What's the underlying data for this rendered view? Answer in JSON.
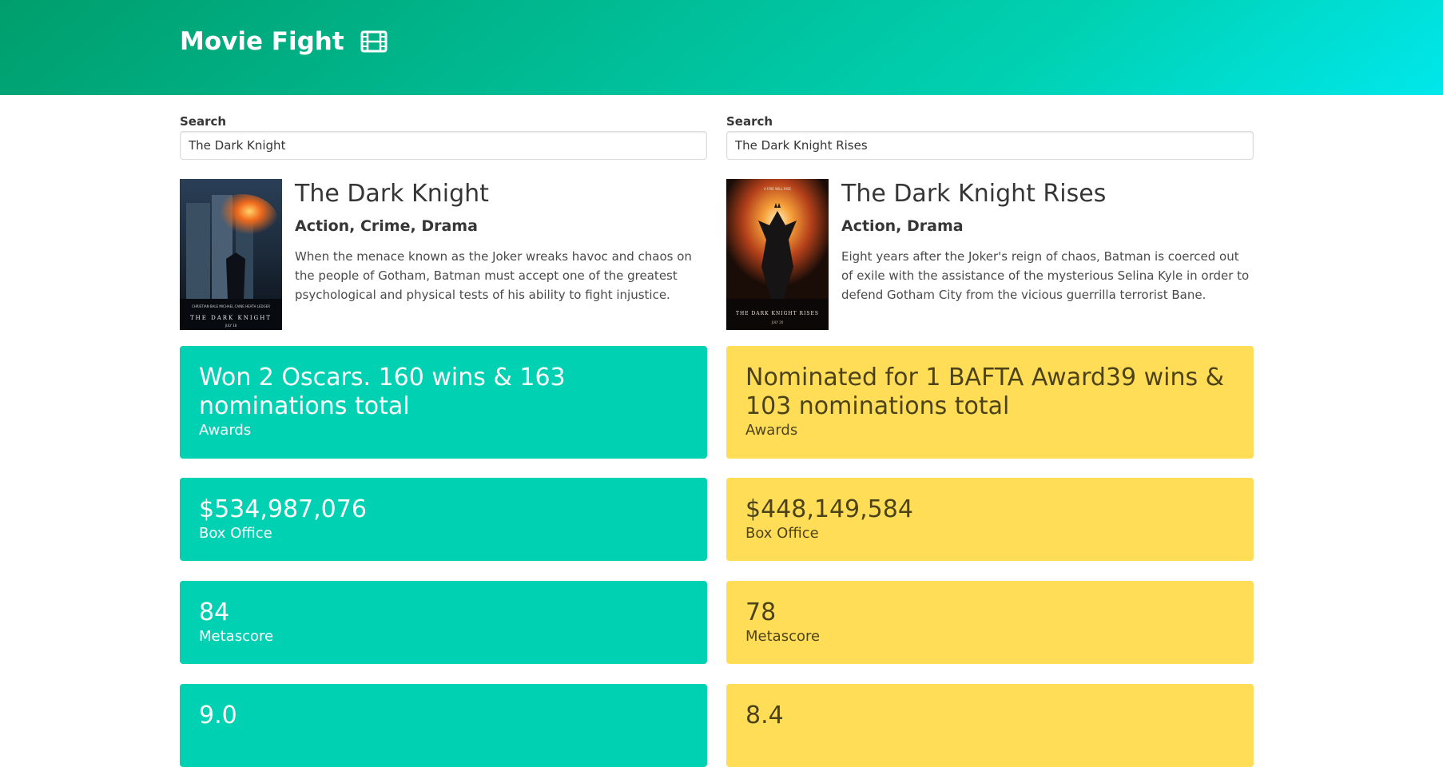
{
  "header": {
    "title": "Movie Fight",
    "icon": "film-icon"
  },
  "colors": {
    "winner": "#00d1b2",
    "loser": "#ffdd57"
  },
  "left": {
    "search_label": "Search",
    "search_value": "The Dark Knight",
    "movie": {
      "title": "The Dark Knight",
      "genre": "Action, Crime, Drama",
      "plot": "When the menace known as the Joker wreaks havoc and chaos on the people of Gotham, Batman must accept one of the greatest psychological and physical tests of his ability to fight injustice.",
      "poster_text": "THE DARK KNIGHT",
      "poster_date": "JULY 18"
    },
    "stats": {
      "awards": {
        "value": "Won 2 Oscars. 160 wins & 163 nominations total",
        "label": "Awards"
      },
      "box_office": {
        "value": "$534,987,076",
        "label": "Box Office"
      },
      "metascore": {
        "value": "84",
        "label": "Metascore"
      },
      "imdb": {
        "value": "9.0"
      }
    }
  },
  "right": {
    "search_label": "Search",
    "search_value": "The Dark Knight Rises",
    "movie": {
      "title": "The Dark Knight Rises",
      "genre": "Action, Drama",
      "plot": "Eight years after the Joker's reign of chaos, Batman is coerced out of exile with the assistance of the mysterious Selina Kyle in order to defend Gotham City from the vicious guerrilla terrorist Bane.",
      "poster_text": "THE DARK KNIGHT RISES",
      "poster_date": "JULY 20"
    },
    "stats": {
      "awards": {
        "value": "Nominated for 1 BAFTA Award39 wins & 103 nominations total",
        "label": "Awards"
      },
      "box_office": {
        "value": "$448,149,584",
        "label": "Box Office"
      },
      "metascore": {
        "value": "78",
        "label": "Metascore"
      },
      "imdb": {
        "value": "8.4"
      }
    }
  }
}
